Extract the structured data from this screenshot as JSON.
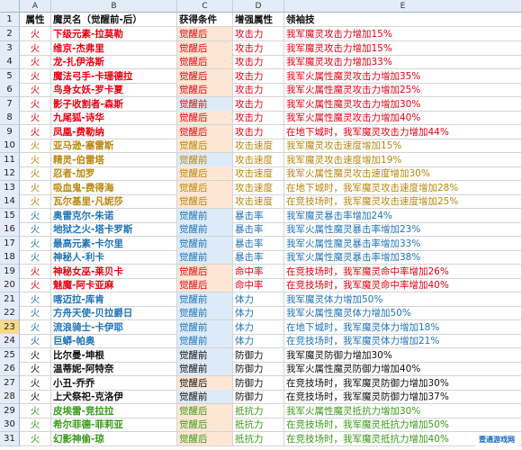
{
  "columns": [
    "A",
    "B",
    "C",
    "D",
    "E"
  ],
  "header": {
    "row": "1",
    "attr": "属性",
    "name": "魔灵名（觉醒前-后）",
    "cond": "获得条件",
    "enh": "增强属性",
    "skill": "领袖技"
  },
  "colors": {
    "red": "#e60012",
    "gold": "#b8860b",
    "blue": "#1f73b7",
    "black": "#111111",
    "green": "#3a9a1a",
    "pink": "#e63b7a",
    "condA": "#fde6d4",
    "condB": "#dcebf7",
    "condC": "#e8f3d8",
    "condD": "#fbe0ea"
  },
  "rows": [
    {
      "n": "2",
      "a": "火",
      "b": "下级元素-拉莫勒",
      "c": "觉醒后",
      "d": "攻击力",
      "e": "我军魔灵攻击力增加15%",
      "col": "red",
      "cc": "condA"
    },
    {
      "n": "3",
      "a": "火",
      "b": "维京-杰弗里",
      "c": "觉醒后",
      "d": "攻击力",
      "e": "我军魔灵攻击力增加15%",
      "col": "red",
      "cc": "condA"
    },
    {
      "n": "4",
      "a": "火",
      "b": "龙-扎伊洛斯",
      "c": "觉醒后",
      "d": "攻击力",
      "e": "我军魔灵攻击力增加33%",
      "col": "red",
      "cc": "condA"
    },
    {
      "n": "5",
      "a": "火",
      "b": "魔法弓手-卡珊德拉",
      "c": "觉醒后",
      "d": "攻击力",
      "e": "我军火属性魔灵攻击力增加35%",
      "col": "red",
      "cc": "condA"
    },
    {
      "n": "6",
      "a": "火",
      "b": "鸟身女妖-罗卡夏",
      "c": "觉醒后",
      "d": "攻击力",
      "e": "我军火属性魔灵攻击力增加25%",
      "col": "red",
      "cc": "condA"
    },
    {
      "n": "7",
      "a": "火",
      "b": "影子收割者-森斯",
      "c": "觉醒前",
      "d": "攻击力",
      "e": "我军火属性魔灵攻击力增加30%",
      "col": "red",
      "cc": "condB"
    },
    {
      "n": "8",
      "a": "火",
      "b": "九尾狐-诗华",
      "c": "觉醒后",
      "d": "攻击力",
      "e": "我军火属性魔灵攻击力增加40%",
      "col": "red",
      "cc": "condA"
    },
    {
      "n": "9",
      "a": "火",
      "b": "凤凰-费勒纳",
      "c": "觉醒后",
      "d": "攻击力",
      "e": "在地下城时，我军魔灵攻击力增加44%",
      "col": "red",
      "cc": "condA"
    },
    {
      "n": "10",
      "a": "火",
      "b": "亚马逊-塞雷斯",
      "c": "觉醒后",
      "d": "攻击速度",
      "e": "我军魔灵攻击速度增加15%",
      "col": "gold",
      "cc": "condA"
    },
    {
      "n": "11",
      "a": "火",
      "b": "精灵-伯雷塔",
      "c": "觉醒前",
      "d": "攻击速度",
      "e": "我军魔灵攻击速度增加19%",
      "col": "gold",
      "cc": "condB"
    },
    {
      "n": "12",
      "a": "火",
      "b": "忍者-加罗",
      "c": "觉醒后",
      "d": "攻击速度",
      "e": "我军火属性魔灵攻击速度增加30%",
      "col": "gold",
      "cc": "condA"
    },
    {
      "n": "13",
      "a": "火",
      "b": "吸血鬼-费得海",
      "c": "觉醒后",
      "d": "攻击速度",
      "e": "在地下城时，我军魔灵攻击速度增加28%",
      "col": "gold",
      "cc": "condA"
    },
    {
      "n": "14",
      "a": "火",
      "b": "瓦尔基里-凡妮莎",
      "c": "觉醒后",
      "d": "攻击速度",
      "e": "在竞技场时，我军魔灵攻击速度增加25%",
      "col": "gold",
      "cc": "condA"
    },
    {
      "n": "15",
      "a": "火",
      "b": "奥雷克尔-朱诺",
      "c": "觉醒前",
      "d": "暴击率",
      "e": "我军魔灵暴击率增加24%",
      "col": "blue",
      "cc": "condB"
    },
    {
      "n": "16",
      "a": "火",
      "b": "地狱之火-塔卡罗斯",
      "c": "觉醒前",
      "d": "暴击率",
      "e": "我军火属性魔灵暴击率增加23%",
      "col": "blue",
      "cc": "condB"
    },
    {
      "n": "17",
      "a": "火",
      "b": "最高元素-卡尔里",
      "c": "觉醒前",
      "d": "暴击率",
      "e": "我军火属性魔灵暴击率增加33%",
      "col": "blue",
      "cc": "condB"
    },
    {
      "n": "18",
      "a": "火",
      "b": "神秘人-利卡",
      "c": "觉醒前",
      "d": "暴击率",
      "e": "我军火属性魔灵暴击率增加38%",
      "col": "blue",
      "cc": "condB"
    },
    {
      "n": "19",
      "a": "火",
      "b": "神秘女巫-莱贝卡",
      "c": "觉醒后",
      "d": "命中率",
      "e": "在竞技场时，我军魔灵命中率增加26%",
      "col": "red",
      "cc": "condA"
    },
    {
      "n": "20",
      "a": "火",
      "b": "魅魔-阿卡亚麻",
      "c": "觉醒后",
      "d": "命中率",
      "e": "在竞技场时，我军魔灵命中率增加40%",
      "col": "red",
      "cc": "condA"
    },
    {
      "n": "21",
      "a": "火",
      "b": "喀迈拉-库肯",
      "c": "觉醒前",
      "d": "体力",
      "e": "我军魔灵体力增加50%",
      "col": "blue",
      "cc": "condB"
    },
    {
      "n": "22",
      "a": "火",
      "b": "方舟天使-贝拉爵日",
      "c": "觉醒前",
      "d": "体力",
      "e": "我军火属性魔灵体力增加50%",
      "col": "blue",
      "cc": "condB"
    },
    {
      "n": "23",
      "a": "火",
      "b": "流浪骑士-卡伊耶",
      "c": "觉醒前",
      "d": "体力",
      "e": "在地下城时，我军魔灵体力增加18%",
      "col": "blue",
      "cc": "condB",
      "sel": true
    },
    {
      "n": "24",
      "a": "火",
      "b": "巨蟒-帕奥",
      "c": "觉醒前",
      "d": "体力",
      "e": "在竞技场时，我军魔灵体力增加21%",
      "col": "blue",
      "cc": "condB"
    },
    {
      "n": "25",
      "a": "火",
      "b": "比尔曼-坤根",
      "c": "觉醒前",
      "d": "防御力",
      "e": "我军魔灵防御力增加30%",
      "col": "black",
      "cc": "condB"
    },
    {
      "n": "26",
      "a": "火",
      "b": "温蒂妮-阿特奈",
      "c": "觉醒前",
      "d": "防御力",
      "e": "我军火属性魔灵防御力增加40%",
      "col": "black",
      "cc": "condB"
    },
    {
      "n": "27",
      "a": "火",
      "b": "小丑-乔乔",
      "c": "觉醒后",
      "d": "防御力",
      "e": "在竞技场时，我军魔灵防御力增加30%",
      "col": "black",
      "cc": "condA"
    },
    {
      "n": "28",
      "a": "火",
      "b": "上犬祭祀-克洛伊",
      "c": "觉醒前",
      "d": "防御力",
      "e": "在竞技场时，我军魔灵防御力增加37%",
      "col": "black",
      "cc": "condB"
    },
    {
      "n": "29",
      "a": "火",
      "b": "皮埃雷-竞拉拉",
      "c": "觉醒后",
      "d": "抵抗力",
      "e": "我军火属性魔灵抵抗力增加30%",
      "col": "green",
      "cc": "condA"
    },
    {
      "n": "30",
      "a": "火",
      "b": "希尔菲德-菲莉亚",
      "c": "觉醒后",
      "d": "抵抗力",
      "e": "在竞技场时，我军魔灵抵抗力增加50%",
      "col": "green",
      "cc": "condA"
    },
    {
      "n": "31",
      "a": "火",
      "b": "幻影神偷-琼",
      "c": "觉醒后",
      "d": "抵抗力",
      "e": "在竞技场时，我军魔灵抵抗力增加40%",
      "col": "green",
      "cc": "condA"
    }
  ],
  "watermark": "壹通游戏网"
}
